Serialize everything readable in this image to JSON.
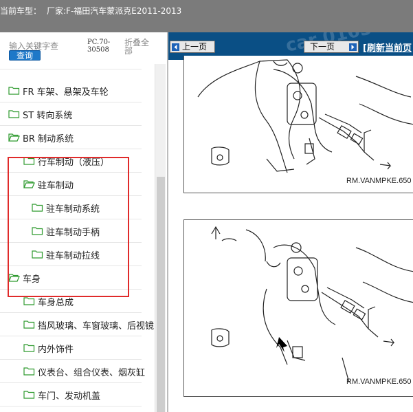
{
  "header": {
    "vehicle_label": "当前车型：",
    "vehicle_value": "厂家:F-福田汽车蒙派克E2011-2013"
  },
  "search": {
    "placeholder": "输入关键字查",
    "query_label": "查询",
    "model_code": "PC.70-30508",
    "collapse_label": "折叠全部"
  },
  "tree": {
    "items": [
      {
        "label": "FR 车架、悬架及车轮",
        "level": 0
      },
      {
        "label": "ST 转向系统",
        "level": 0
      },
      {
        "label": "BR 制动系统",
        "level": 0,
        "open": true
      },
      {
        "label": "行车制动（液压）",
        "level": 1
      },
      {
        "label": "驻车制动",
        "level": 1,
        "open": true
      },
      {
        "label": "驻车制动系统",
        "level": 2
      },
      {
        "label": "驻车制动手柄",
        "level": 2
      },
      {
        "label": "驻车制动拉线",
        "level": 2
      },
      {
        "label": "车身",
        "level": 0,
        "open": true
      },
      {
        "label": "车身总成",
        "level": 1
      },
      {
        "label": "挡风玻璃、车窗玻璃、后视镜",
        "level": 1
      },
      {
        "label": "内外饰件",
        "level": 1
      },
      {
        "label": "仪表台、组合仪表、烟灰缸",
        "level": 1
      },
      {
        "label": "车门、发动机盖",
        "level": 1
      }
    ]
  },
  "viewer": {
    "prev_label": "上一页",
    "next_label": "下一页",
    "refresh_label": "[刷新当前页",
    "figure1_code": "RM.VANMPKE.650",
    "figure2_code": "RM.VANMPKE.650"
  },
  "colors": {
    "title_bar": "#7b7b7b",
    "nav_bar": "#0a4f85",
    "folder": "#2e9a2e",
    "highlight": "#e02a2a"
  }
}
